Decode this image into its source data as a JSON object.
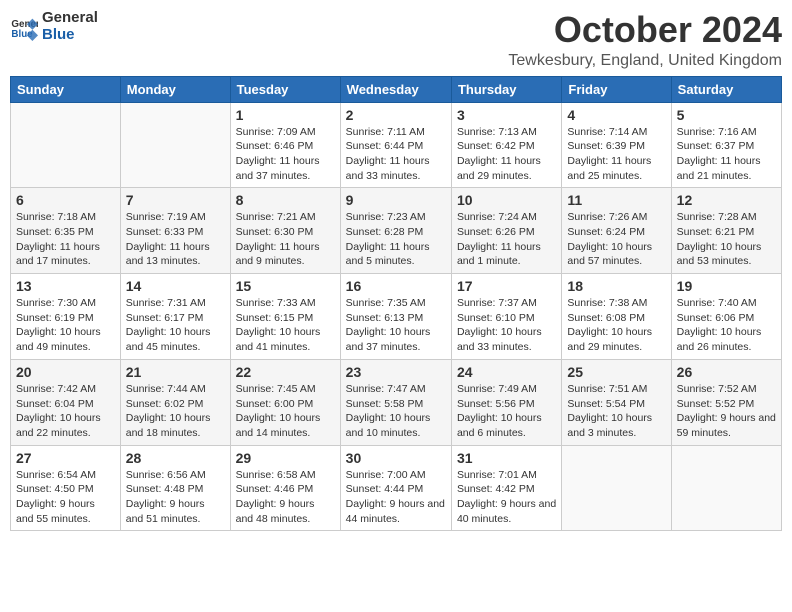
{
  "header": {
    "logo_general": "General",
    "logo_blue": "Blue",
    "month": "October 2024",
    "location": "Tewkesbury, England, United Kingdom"
  },
  "columns": [
    "Sunday",
    "Monday",
    "Tuesday",
    "Wednesday",
    "Thursday",
    "Friday",
    "Saturday"
  ],
  "weeks": [
    [
      {
        "day": "",
        "info": ""
      },
      {
        "day": "",
        "info": ""
      },
      {
        "day": "1",
        "info": "Sunrise: 7:09 AM\nSunset: 6:46 PM\nDaylight: 11 hours and 37 minutes."
      },
      {
        "day": "2",
        "info": "Sunrise: 7:11 AM\nSunset: 6:44 PM\nDaylight: 11 hours and 33 minutes."
      },
      {
        "day": "3",
        "info": "Sunrise: 7:13 AM\nSunset: 6:42 PM\nDaylight: 11 hours and 29 minutes."
      },
      {
        "day": "4",
        "info": "Sunrise: 7:14 AM\nSunset: 6:39 PM\nDaylight: 11 hours and 25 minutes."
      },
      {
        "day": "5",
        "info": "Sunrise: 7:16 AM\nSunset: 6:37 PM\nDaylight: 11 hours and 21 minutes."
      }
    ],
    [
      {
        "day": "6",
        "info": "Sunrise: 7:18 AM\nSunset: 6:35 PM\nDaylight: 11 hours and 17 minutes."
      },
      {
        "day": "7",
        "info": "Sunrise: 7:19 AM\nSunset: 6:33 PM\nDaylight: 11 hours and 13 minutes."
      },
      {
        "day": "8",
        "info": "Sunrise: 7:21 AM\nSunset: 6:30 PM\nDaylight: 11 hours and 9 minutes."
      },
      {
        "day": "9",
        "info": "Sunrise: 7:23 AM\nSunset: 6:28 PM\nDaylight: 11 hours and 5 minutes."
      },
      {
        "day": "10",
        "info": "Sunrise: 7:24 AM\nSunset: 6:26 PM\nDaylight: 11 hours and 1 minute."
      },
      {
        "day": "11",
        "info": "Sunrise: 7:26 AM\nSunset: 6:24 PM\nDaylight: 10 hours and 57 minutes."
      },
      {
        "day": "12",
        "info": "Sunrise: 7:28 AM\nSunset: 6:21 PM\nDaylight: 10 hours and 53 minutes."
      }
    ],
    [
      {
        "day": "13",
        "info": "Sunrise: 7:30 AM\nSunset: 6:19 PM\nDaylight: 10 hours and 49 minutes."
      },
      {
        "day": "14",
        "info": "Sunrise: 7:31 AM\nSunset: 6:17 PM\nDaylight: 10 hours and 45 minutes."
      },
      {
        "day": "15",
        "info": "Sunrise: 7:33 AM\nSunset: 6:15 PM\nDaylight: 10 hours and 41 minutes."
      },
      {
        "day": "16",
        "info": "Sunrise: 7:35 AM\nSunset: 6:13 PM\nDaylight: 10 hours and 37 minutes."
      },
      {
        "day": "17",
        "info": "Sunrise: 7:37 AM\nSunset: 6:10 PM\nDaylight: 10 hours and 33 minutes."
      },
      {
        "day": "18",
        "info": "Sunrise: 7:38 AM\nSunset: 6:08 PM\nDaylight: 10 hours and 29 minutes."
      },
      {
        "day": "19",
        "info": "Sunrise: 7:40 AM\nSunset: 6:06 PM\nDaylight: 10 hours and 26 minutes."
      }
    ],
    [
      {
        "day": "20",
        "info": "Sunrise: 7:42 AM\nSunset: 6:04 PM\nDaylight: 10 hours and 22 minutes."
      },
      {
        "day": "21",
        "info": "Sunrise: 7:44 AM\nSunset: 6:02 PM\nDaylight: 10 hours and 18 minutes."
      },
      {
        "day": "22",
        "info": "Sunrise: 7:45 AM\nSunset: 6:00 PM\nDaylight: 10 hours and 14 minutes."
      },
      {
        "day": "23",
        "info": "Sunrise: 7:47 AM\nSunset: 5:58 PM\nDaylight: 10 hours and 10 minutes."
      },
      {
        "day": "24",
        "info": "Sunrise: 7:49 AM\nSunset: 5:56 PM\nDaylight: 10 hours and 6 minutes."
      },
      {
        "day": "25",
        "info": "Sunrise: 7:51 AM\nSunset: 5:54 PM\nDaylight: 10 hours and 3 minutes."
      },
      {
        "day": "26",
        "info": "Sunrise: 7:52 AM\nSunset: 5:52 PM\nDaylight: 9 hours and 59 minutes."
      }
    ],
    [
      {
        "day": "27",
        "info": "Sunrise: 6:54 AM\nSunset: 4:50 PM\nDaylight: 9 hours and 55 minutes."
      },
      {
        "day": "28",
        "info": "Sunrise: 6:56 AM\nSunset: 4:48 PM\nDaylight: 9 hours and 51 minutes."
      },
      {
        "day": "29",
        "info": "Sunrise: 6:58 AM\nSunset: 4:46 PM\nDaylight: 9 hours and 48 minutes."
      },
      {
        "day": "30",
        "info": "Sunrise: 7:00 AM\nSunset: 4:44 PM\nDaylight: 9 hours and 44 minutes."
      },
      {
        "day": "31",
        "info": "Sunrise: 7:01 AM\nSunset: 4:42 PM\nDaylight: 9 hours and 40 minutes."
      },
      {
        "day": "",
        "info": ""
      },
      {
        "day": "",
        "info": ""
      }
    ]
  ]
}
